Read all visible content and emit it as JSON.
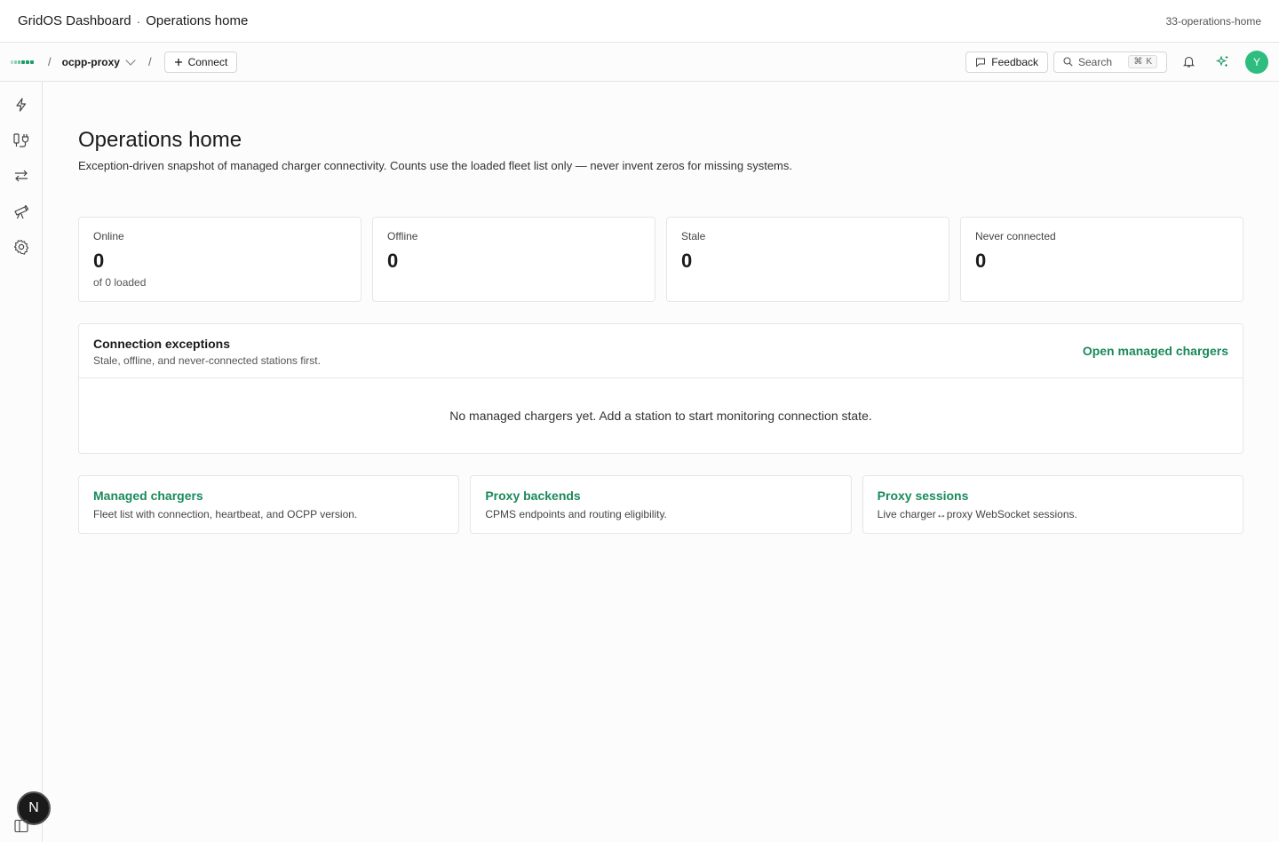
{
  "titlebar": {
    "app_name": "GridOS Dashboard",
    "separator": "·",
    "page_name": "Operations home",
    "route": "33-operations-home"
  },
  "topnav": {
    "slash": "/",
    "project": "ocpp-proxy",
    "connect_label": "Connect",
    "feedback_label": "Feedback",
    "search_label": "Search",
    "search_shortcut_mod": "⌘",
    "search_shortcut_key": "K",
    "avatar_initial": "Y"
  },
  "sidebar": {
    "items": [
      {
        "icon": "bolt-icon"
      },
      {
        "icon": "plug-icon"
      },
      {
        "icon": "arrows-icon"
      },
      {
        "icon": "telescope-icon"
      },
      {
        "icon": "gear-icon"
      }
    ],
    "badge": "N"
  },
  "main": {
    "title": "Operations home",
    "description": "Exception-driven snapshot of managed charger connectivity. Counts use the loaded fleet list only — never invent zeros for missing systems.",
    "stats": [
      {
        "label": "Online",
        "value": "0",
        "sub": "of 0 loaded"
      },
      {
        "label": "Offline",
        "value": "0"
      },
      {
        "label": "Stale",
        "value": "0"
      },
      {
        "label": "Never connected",
        "value": "0"
      }
    ],
    "exceptions": {
      "title": "Connection exceptions",
      "subtitle": "Stale, offline, and never-connected stations first.",
      "link": "Open managed chargers",
      "empty": "No managed chargers yet. Add a station to start monitoring connection state."
    },
    "links": [
      {
        "title": "Managed chargers",
        "desc": "Fleet list with connection, heartbeat, and OCPP version."
      },
      {
        "title": "Proxy backends",
        "desc": "CPMS endpoints and routing eligibility."
      },
      {
        "title": "Proxy sessions",
        "desc": "Live charger↔proxy WebSocket sessions."
      }
    ]
  },
  "colors": {
    "accent": "#1a8a5c",
    "avatar": "#2dbd7e"
  }
}
